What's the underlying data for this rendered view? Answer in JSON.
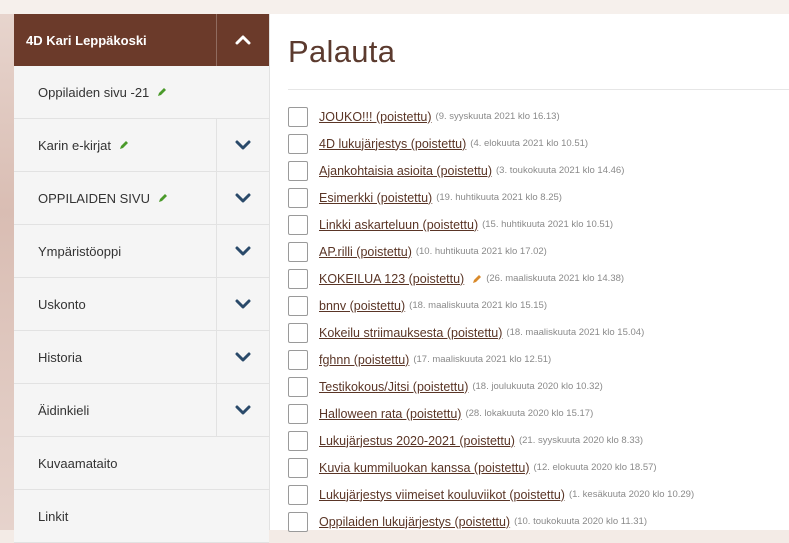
{
  "sidebar": {
    "header": "4D Kari Leppäkoski",
    "items": [
      {
        "label": "Oppilaiden sivu -21",
        "edit": true,
        "toggle": false
      },
      {
        "label": "Karin e-kirjat",
        "edit": true,
        "toggle": true
      },
      {
        "label": "OPPILAIDEN SIVU",
        "edit": true,
        "toggle": true
      },
      {
        "label": "Ympäristöoppi",
        "edit": false,
        "toggle": true
      },
      {
        "label": "Uskonto",
        "edit": false,
        "toggle": true
      },
      {
        "label": "Historia",
        "edit": false,
        "toggle": true
      },
      {
        "label": "Äidinkieli",
        "edit": false,
        "toggle": true
      },
      {
        "label": "Kuvaamataito",
        "edit": false,
        "toggle": false
      },
      {
        "label": "Linkit",
        "edit": false,
        "toggle": false
      }
    ]
  },
  "main": {
    "title": "Palauta",
    "items": [
      {
        "title": "JOUKO!!! (poistettu)",
        "meta": "(9. syyskuuta 2021 klo 16.13)",
        "edit": false
      },
      {
        "title": "4D lukujärjestys (poistettu)",
        "meta": "(4. elokuuta 2021 klo 10.51)",
        "edit": false
      },
      {
        "title": "Ajankohtaisia asioita (poistettu)",
        "meta": "(3. toukokuuta 2021 klo 14.46)",
        "edit": false
      },
      {
        "title": "Esimerkki (poistettu)",
        "meta": "(19. huhtikuuta 2021 klo 8.25)",
        "edit": false
      },
      {
        "title": "Linkki askarteluun (poistettu)",
        "meta": "(15. huhtikuuta 2021 klo 10.51)",
        "edit": false
      },
      {
        "title": "AP.rilli (poistettu)",
        "meta": "(10. huhtikuuta 2021 klo 17.02)",
        "edit": false
      },
      {
        "title": "KOKEILUA 123 (poistettu)",
        "meta": "(26. maaliskuuta 2021 klo 14.38)",
        "edit": true
      },
      {
        "title": "bnnv (poistettu)",
        "meta": "(18. maaliskuuta 2021 klo 15.15)",
        "edit": false
      },
      {
        "title": "Kokeilu striimauksesta (poistettu)",
        "meta": "(18. maaliskuuta 2021 klo 15.04)",
        "edit": false
      },
      {
        "title": "fghnn (poistettu)",
        "meta": "(17. maaliskuuta 2021 klo 12.51)",
        "edit": false
      },
      {
        "title": "Testikokous/Jitsi (poistettu)",
        "meta": "(18. joulukuuta 2020 klo 10.32)",
        "edit": false
      },
      {
        "title": "Halloween rata (poistettu)",
        "meta": "(28. lokakuuta 2020 klo 15.17)",
        "edit": false
      },
      {
        "title": "Lukujärjestus 2020-2021 (poistettu)",
        "meta": "(21. syyskuuta 2020 klo 8.33)",
        "edit": false
      },
      {
        "title": "Kuvia kummiluokan kanssa (poistettu)",
        "meta": "(12. elokuuta 2020 klo 18.57)",
        "edit": false
      },
      {
        "title": "Lukujärjestys viimeiset kouluviikot (poistettu)",
        "meta": "(1. kesäkuuta 2020 klo 10.29)",
        "edit": false
      },
      {
        "title": "Oppilaiden lukujärjestys (poistettu)",
        "meta": "(10. toukokuuta 2020 klo 11.31)",
        "edit": false
      }
    ]
  },
  "colors": {
    "brand": "#6b3a2a",
    "link": "#5a3526",
    "pencil_green": "#4a9a2a",
    "pencil_orange": "#d98a2b"
  },
  "icons": {
    "collapse": "chevron-up-icon",
    "expand": "chevron-down-icon",
    "edit": "pencil-icon"
  }
}
